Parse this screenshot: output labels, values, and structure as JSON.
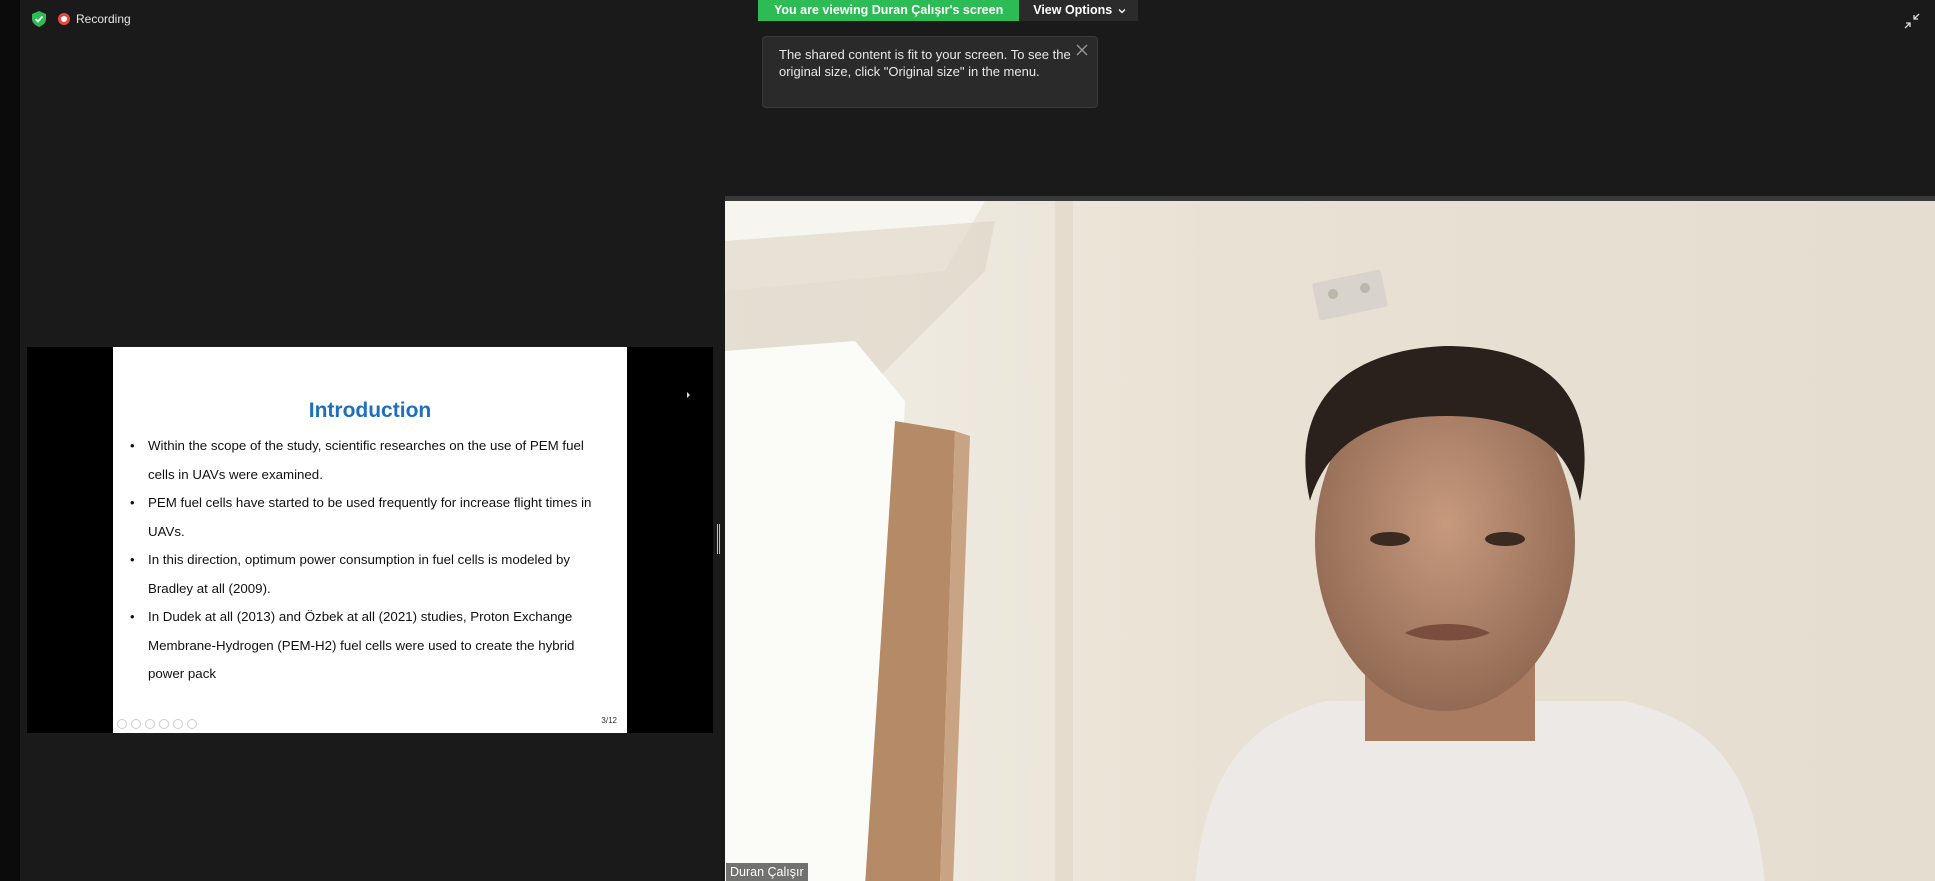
{
  "status": {
    "recording_label": "Recording"
  },
  "banner": {
    "viewing_text": "You are viewing Duran Çalışır's screen",
    "view_options_label": "View Options"
  },
  "tooltip": {
    "text": "The shared content is fit to your screen. To see the original size, click \"Original size\" in the menu."
  },
  "slide": {
    "title": "Introduction",
    "bullets": [
      "Within the scope of the study, scientific researches on the use of PEM fuel cells in UAVs were examined.",
      "PEM fuel cells have started to be used frequently for increase flight times in UAVs.",
      "In this direction, optimum power consumption in fuel cells is modeled by Bradley at all (2009).",
      "In Dudek at all (2013) and Özbek at all (2021) studies, Proton Exchange Membrane-Hydrogen (PEM-H2) fuel cells were used to create the hybrid power pack"
    ],
    "page_number": "3/12"
  },
  "video": {
    "participant_name": "Duran Çalışır"
  },
  "colors": {
    "banner_green": "#2dbb55",
    "slide_title_blue": "#1f6fc0",
    "recording_red": "#e8493f",
    "background": "#1a1a1a"
  },
  "icons": [
    "shield-check-icon",
    "recording-icon",
    "chevron-down-icon",
    "close-icon",
    "exit-fullscreen-icon"
  ]
}
